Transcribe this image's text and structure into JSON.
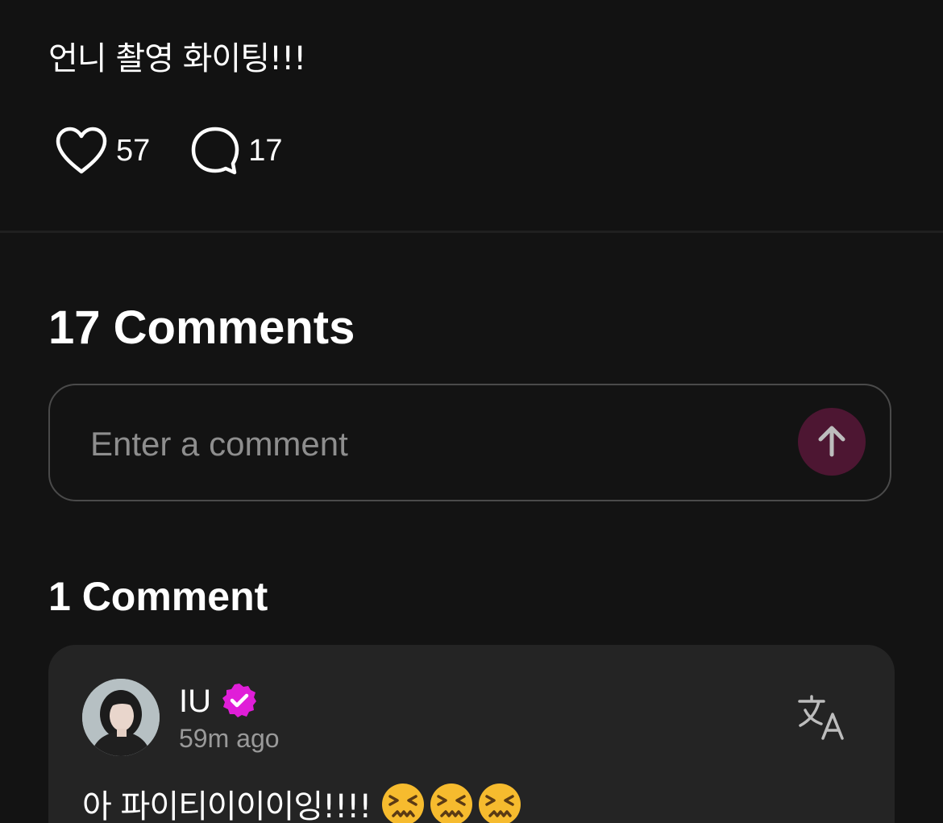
{
  "post": {
    "text": "언니 촬영 화이팅!!!",
    "likes": "57",
    "comments": "17"
  },
  "comments_section": {
    "title": "17 Comments",
    "input_placeholder": "Enter a comment"
  },
  "highlighted": {
    "title": "1 Comment",
    "comment": {
      "author": "IU",
      "time": "59m ago",
      "text": "아 파이티이이이잉!!!!",
      "emoji_count": 3
    }
  },
  "colors": {
    "background": "#131313",
    "card": "#242424",
    "send_button": "#4d1632",
    "verified_badge": "#e01ed8",
    "muted_text": "#9a9a9a"
  },
  "icons": {
    "like": "heart-icon",
    "comment": "speech-bubble-icon",
    "send": "arrow-up-icon",
    "verified": "verified-badge-icon",
    "translate": "translate-icon",
    "emoji": "confounded-face-emoji"
  }
}
